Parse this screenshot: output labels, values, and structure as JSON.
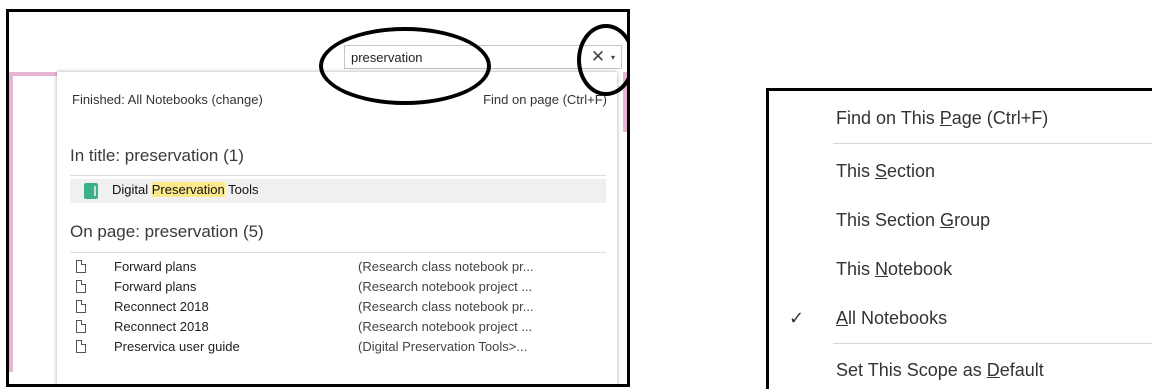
{
  "search": {
    "value": "preservation",
    "clear_glyph": "✕",
    "dropdown_glyph": "▾"
  },
  "results": {
    "status_text": "Finished: All Notebooks (change)",
    "find_on_page": "Find on page (Ctrl+F)",
    "title_heading": "In title:  preservation (1)",
    "title_result": {
      "before": "Digital ",
      "highlight": "Preservation",
      "after": " Tools"
    },
    "page_heading": "On page:  preservation (5)",
    "pages": [
      {
        "name": "Forward plans",
        "path": "(Research class notebook pr..."
      },
      {
        "name": "Forward plans",
        "path": "(Research notebook project ..."
      },
      {
        "name": "Reconnect 2018",
        "path": "(Research class notebook pr..."
      },
      {
        "name": "Reconnect 2018",
        "path": "(Research notebook project ..."
      },
      {
        "name": "Preservica user guide",
        "path": "(Digital Preservation Tools>..."
      }
    ]
  },
  "scope_menu": {
    "items": [
      {
        "pre": "Find on This ",
        "key": "P",
        "post": "age (Ctrl+F)",
        "checked": false
      },
      {
        "pre": "This ",
        "key": "S",
        "post": "ection",
        "checked": false
      },
      {
        "pre": "This Section ",
        "key": "G",
        "post": "roup",
        "checked": false
      },
      {
        "pre": "This ",
        "key": "N",
        "post": "otebook",
        "checked": false
      },
      {
        "pre": "",
        "key": "A",
        "post": "ll Notebooks",
        "checked": true
      },
      {
        "pre": "Set This Scope as ",
        "key": "D",
        "post": "efault",
        "checked": false
      }
    ],
    "check_glyph": "✓"
  },
  "colors": {
    "highlight": "#fbe88a",
    "notebook_icon": "#3bb08a",
    "accent_pink": "#e8b4d4"
  },
  "icons": {
    "title_result": "notebook-section-icon",
    "page_result": "page-icon"
  }
}
